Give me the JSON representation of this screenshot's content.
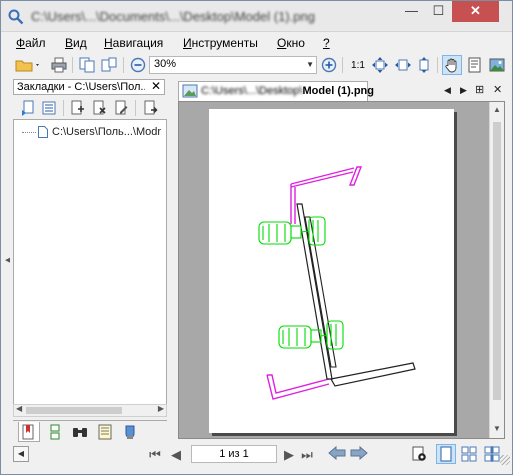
{
  "window": {
    "title": "C:\\Users\\...\\Documents\\...\\Desktop\\Model (1).png",
    "min_glyph": "—",
    "max_glyph": "☐",
    "close_glyph": "✕"
  },
  "menu": [
    {
      "label": "Файл",
      "accel": "Ф"
    },
    {
      "label": "Вид",
      "accel": "В"
    },
    {
      "label": "Навигация",
      "accel": "Н"
    },
    {
      "label": "Инструменты",
      "accel": "И"
    },
    {
      "label": "Окно",
      "accel": "О"
    },
    {
      "label": "?",
      "accel": "?"
    }
  ],
  "toolbar": {
    "zoom_value": "30%",
    "actual_size_label": "1:1",
    "icons": [
      "open-folder-icon",
      "print-icon",
      "copy-page-icon",
      "fit-pages-icon",
      "zoom-out-icon",
      "zoom-in-icon",
      "fit-page-icon",
      "fit-width-icon",
      "fit-height-icon",
      "hand-tool-icon",
      "properties-icon",
      "image-icon"
    ]
  },
  "bookmarks_panel": {
    "title": "Закладки - C:\\Users\\Пол...",
    "close_glyph": "✕",
    "tree_item": "C:\\Users\\Поль...\\Modr",
    "tabs": [
      "bookmarks-tab-icon",
      "thumbnails-tab-icon",
      "search-tab-icon",
      "notes-tab-icon",
      "info-tab-icon"
    ]
  },
  "document_tab": {
    "title_blurred": "C:\\Users\\...\\Desktop\\",
    "title_clear": "Model (1).png"
  },
  "navigation": {
    "page_display": "1 из 1"
  },
  "colors": {
    "accent_blue": "#cde4f7",
    "bolt_green": "#00dd00",
    "bracket_magenta": "#e020e0",
    "close_red": "#c75050"
  }
}
